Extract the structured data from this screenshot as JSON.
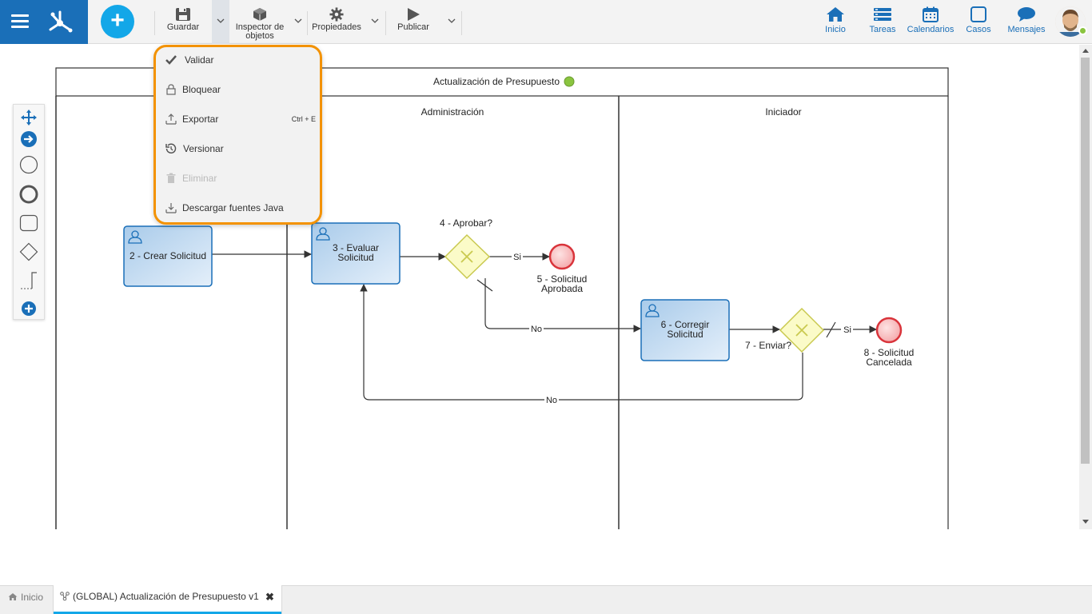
{
  "toolbar": {
    "save": "Guardar",
    "inspector_line1": "Inspector de",
    "inspector_line2": "objetos",
    "properties": "Propiedades",
    "publish": "Publicar"
  },
  "nav": {
    "home": "Inicio",
    "tasks": "Tareas",
    "calendars": "Calendarios",
    "cases": "Casos",
    "messages": "Mensajes"
  },
  "dropdown": {
    "validate": "Validar",
    "lock": "Bloquear",
    "export": "Exportar",
    "export_shortcut": "Ctrl + E",
    "version": "Versionar",
    "delete": "Eliminar",
    "download_java": "Descargar fuentes Java"
  },
  "diagram": {
    "pool_title": "Actualización de Presupuesto",
    "lane_admin": "Administración",
    "lane_initiator": "Iniciador",
    "task2": "2 - Crear Solicitud",
    "task3_line1": "3 - Evaluar",
    "task3_line2": "Solicitud",
    "gateway4": "4 - Aprobar?",
    "end5_line1": "5 - Solicitud",
    "end5_line2": "Aprobada",
    "task6_line1": "6 - Corregir",
    "task6_line2": "Solicitud",
    "gateway7": "7 - Enviar?",
    "end8_line1": "8 - Solicitud",
    "end8_line2": "Cancelada",
    "flow_si_1": "Si",
    "flow_no_1": "No",
    "flow_si_2": "Si",
    "flow_no_2": "No"
  },
  "tabs": {
    "home": "Inicio",
    "active": "(GLOBAL) Actualización de Presupuesto v1"
  },
  "colors": {
    "brand": "#1a6fb8",
    "accent": "#13a7e8",
    "highlight": "#f39200",
    "status_ok": "#8ac43f"
  }
}
